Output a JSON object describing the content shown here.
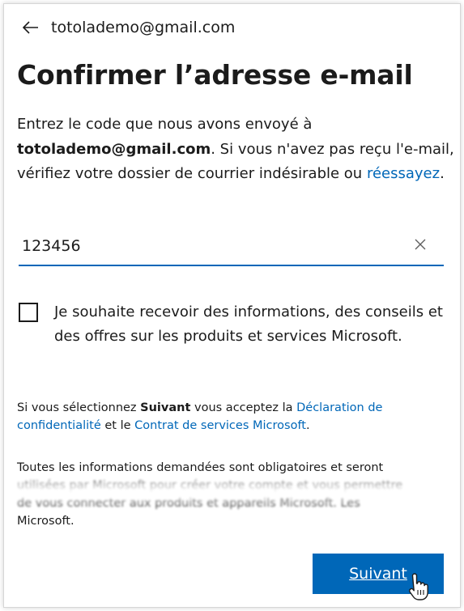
{
  "header": {
    "back_icon": "arrow-left-icon",
    "email": "totolademo@gmail.com"
  },
  "title": "Confirmer l’adresse e-mail",
  "description": {
    "part1": "Entrez le code que nous avons envoyé à ",
    "email": "totolademo@gmail.com",
    "part2": ". Si vous n'avez pas reçu l'e-mail, vérifiez votre dossier de courrier indésirable ou ",
    "retry_link": "réessayez",
    "part3": "."
  },
  "code_input": {
    "value": "123456",
    "clear_icon": "close-icon"
  },
  "checkbox": {
    "checked": false,
    "label": "Je souhaite recevoir des informations, des conseils et des offres sur les produits et services Microsoft."
  },
  "legal": {
    "part1": "Si vous sélectionnez ",
    "bold": "Suivant",
    "part2": " vous acceptez la ",
    "privacy_link": "Déclaration de confidentialité",
    "part3": " et le ",
    "services_link": "Contrat de services Microsoft",
    "part4": "."
  },
  "info": {
    "line1": "Toutes les informations demandées sont obligatoires et seront",
    "line2": "utilisées par Microsoft pour créer votre compte et vous permettre",
    "line3": "de vous connecter aux produits et appareils Microsoft. Les",
    "line4": "Microsoft."
  },
  "next_button": {
    "label": "Suivant"
  },
  "colors": {
    "accent": "#0067b8",
    "text": "#1b1b1b"
  }
}
